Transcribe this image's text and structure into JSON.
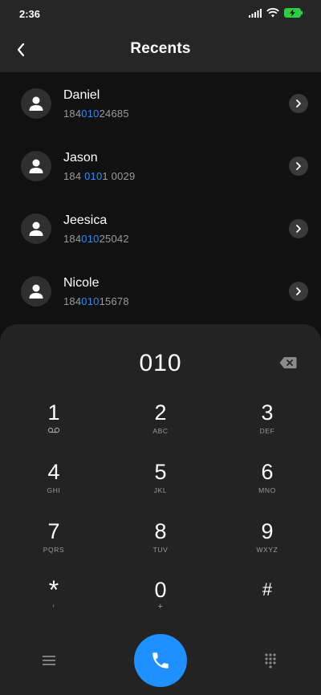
{
  "status": {
    "time": "2:36"
  },
  "header": {
    "title": "Recents"
  },
  "contacts": [
    {
      "name": "Daniel",
      "number_pre": "184",
      "number_hl": "010",
      "number_post": "24685"
    },
    {
      "name": "Jason",
      "number_pre": "184 ",
      "number_hl": "010",
      "number_post": "1 0029"
    },
    {
      "name": "Jeesica",
      "number_pre": "184",
      "number_hl": "010",
      "number_post": "25042"
    },
    {
      "name": "Nicole",
      "number_pre": "184",
      "number_hl": "010",
      "number_post": "15678"
    }
  ],
  "dialer": {
    "entered": "010",
    "keys": [
      {
        "digit": "1",
        "letters": ""
      },
      {
        "digit": "2",
        "letters": "ABC"
      },
      {
        "digit": "3",
        "letters": "DEF"
      },
      {
        "digit": "4",
        "letters": "GHI"
      },
      {
        "digit": "5",
        "letters": "JKL"
      },
      {
        "digit": "6",
        "letters": "MNO"
      },
      {
        "digit": "7",
        "letters": "PQRS"
      },
      {
        "digit": "8",
        "letters": "TUV"
      },
      {
        "digit": "9",
        "letters": "WXYZ"
      },
      {
        "digit": "*",
        "letters": ","
      },
      {
        "digit": "0",
        "letters": "+"
      },
      {
        "digit": "#",
        "letters": ""
      }
    ]
  },
  "colors": {
    "accent": "#1e90ff",
    "background": "#111111",
    "pad": "#232323"
  },
  "icons": [
    "signal-icon",
    "wifi-icon",
    "battery-icon",
    "back-icon",
    "avatar-icon",
    "chevron-right-icon",
    "backspace-icon",
    "voicemail-icon",
    "menu-icon",
    "phone-icon",
    "dialpad-icon"
  ]
}
